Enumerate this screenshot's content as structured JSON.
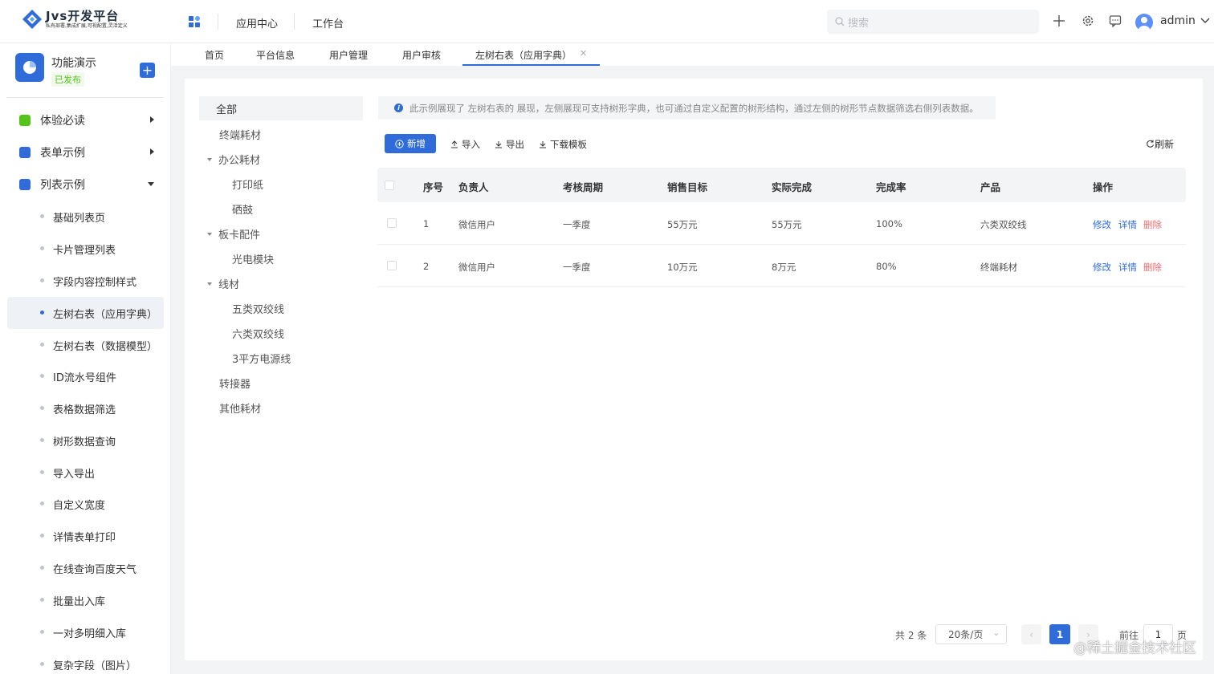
{
  "brand": {
    "title": "Jvs开发平台",
    "subtitle": "私有部署,集成扩展,可视配置,灵活定义"
  },
  "header": {
    "nav": [
      "应用中心",
      "工作台"
    ],
    "search_placeholder": "搜索",
    "user": "admin"
  },
  "app": {
    "name": "功能演示",
    "status": "已发布"
  },
  "sidebar": {
    "groups": [
      {
        "label": "体验必读",
        "icon": "book-icon",
        "color": "#52c41a"
      },
      {
        "label": "表单示例",
        "icon": "form-icon",
        "color": "#2f6bd9"
      },
      {
        "label": "列表示例",
        "icon": "list-icon",
        "color": "#2f6bd9"
      }
    ],
    "items": [
      "基础列表页",
      "卡片管理列表",
      "字段内容控制样式",
      "左树右表（应用字典）",
      "左树右表（数据模型）",
      "ID流水号组件",
      "表格数据筛选",
      "树形数据查询",
      "导入导出",
      "自定义宽度",
      "详情表单打印",
      "在线查询百度天气",
      "批量出入库",
      "一对多明细入库",
      "复杂字段（图片）"
    ]
  },
  "tabs": [
    "首页",
    "平台信息",
    "用户管理",
    "用户审核",
    "左树右表（应用字典）"
  ],
  "tree": {
    "all": "全部",
    "nodes": [
      "终端耗材",
      "办公耗材",
      "打印纸",
      "硒鼓",
      "板卡配件",
      "光电模块",
      "线材",
      "五类双绞线",
      "六类双绞线",
      "3平方电源线",
      "转接器",
      "其他耗材"
    ]
  },
  "notice": "此示例展现了 左树右表的 展现，左侧展现可支持树形字典，也可通过自定义配置的树形结构，通过左侧的树形节点数据筛选右侧列表数据。",
  "toolbar": {
    "new": "新增",
    "import": "导入",
    "export": "导出",
    "template": "下载模板",
    "refresh": "刷新"
  },
  "table": {
    "columns": [
      "序号",
      "负责人",
      "考核周期",
      "销售目标",
      "实际完成",
      "完成率",
      "产品",
      "操作"
    ],
    "rows": [
      [
        "1",
        "微信用户",
        "一季度",
        "55万元",
        "55万元",
        "100%",
        "六类双绞线"
      ],
      [
        "2",
        "微信用户",
        "一季度",
        "10万元",
        "8万元",
        "80%",
        "终端耗材"
      ]
    ],
    "actions": [
      "修改",
      "详情",
      "删除"
    ]
  },
  "pagination": {
    "total": "共 2 条",
    "page_size": "20条/页",
    "current": "1",
    "goto_prefix": "前往",
    "goto_value": "1",
    "goto_suffix": "页"
  },
  "watermark": "@稀土掘金技术社区",
  "colors": {
    "primary": "#2f6bd9",
    "danger": "#f56c6c",
    "success": "#52c41a"
  }
}
